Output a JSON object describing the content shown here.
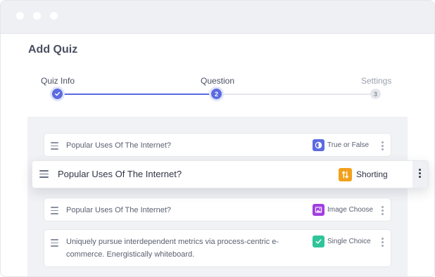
{
  "page": {
    "title": "Add Quiz"
  },
  "stepper": {
    "steps": [
      {
        "label": "Quiz Info",
        "number": "",
        "state": "completed"
      },
      {
        "label": "Question",
        "number": "2",
        "state": "active"
      },
      {
        "label": "Settings",
        "number": "3",
        "state": "upcoming"
      }
    ]
  },
  "questions": [
    {
      "text": "Popular Uses Of The Internet?",
      "type": "True or False",
      "type_icon": "contrast-circle-icon",
      "color": "#5b6be0"
    },
    {
      "text": "Popular Uses Of The Internet?",
      "type": "Shorting",
      "type_icon": "sort-arrows-icon",
      "color": "#f2a01a",
      "dragging": true
    },
    {
      "text": "Popular Uses Of The Internet?",
      "type": "Image Choose",
      "type_icon": "image-icon",
      "color": "#a13fe0"
    },
    {
      "text": "Uniquely pursue interdependent metrics via process-centric e-commerce. Energistically whiteboard.",
      "type": "Single Choice",
      "type_icon": "check-icon",
      "color": "#2fc49a"
    }
  ],
  "colors": {
    "accent": "#5b6be0",
    "step_done": "#5b6be0",
    "step_upcoming": "#e5e7ec",
    "panel": "#f1f2f5"
  }
}
